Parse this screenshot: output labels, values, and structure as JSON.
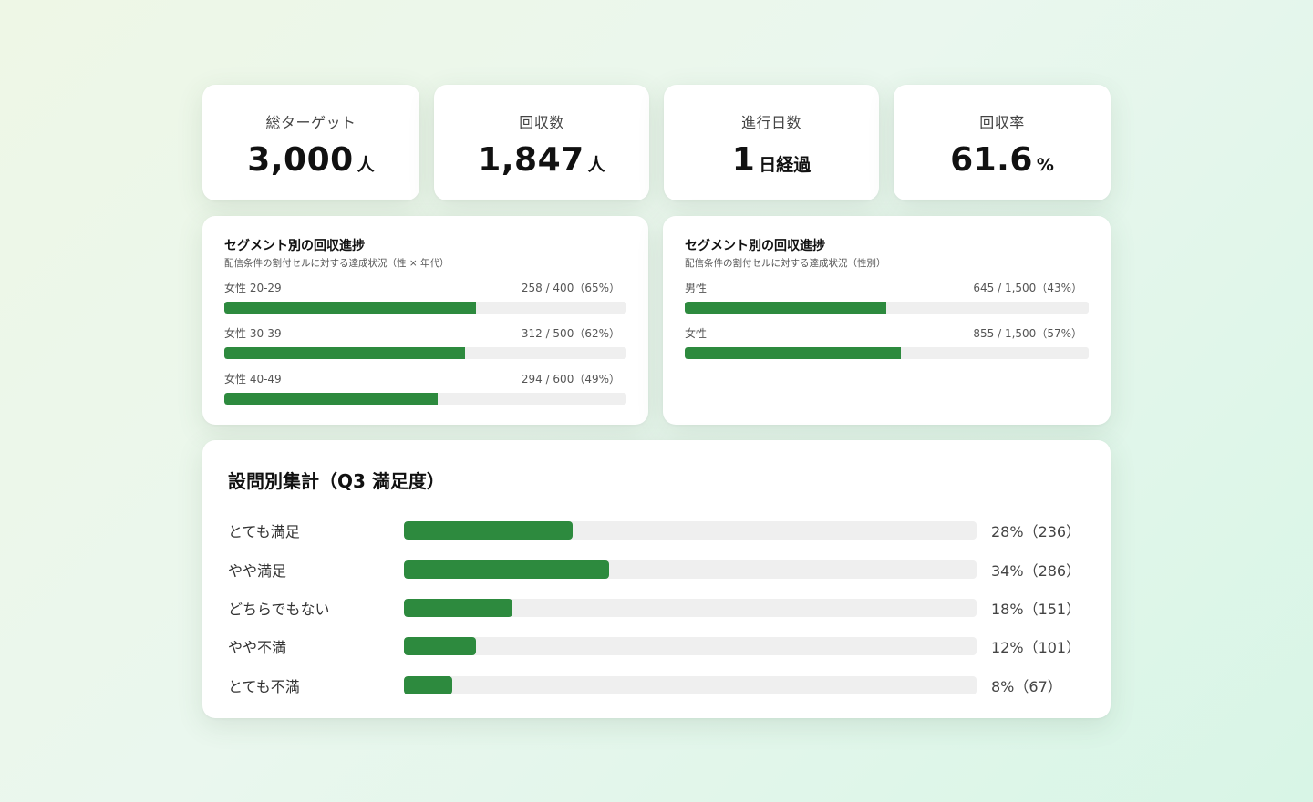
{
  "kpis": [
    {
      "label": "総ターゲット",
      "value": "3,000",
      "unit": "人"
    },
    {
      "label": "回収数",
      "value": "1,847",
      "unit": "人"
    },
    {
      "label": "進行日数",
      "value": "1",
      "unit": "日経過"
    },
    {
      "label": "回収率",
      "value": "61.6",
      "unit": "%"
    }
  ],
  "segment_cards": [
    {
      "title": "セグメント別の回収進捗",
      "subtitle": "配信条件の割付セルに対する達成状況（性 × 年代）",
      "rows": [
        {
          "label": "女性 20-29",
          "value_text": "258 / 400（65%）",
          "progress": 0.625
        },
        {
          "label": "女性 30-39",
          "value_text": "312 / 500（62%）",
          "progress": 0.598
        },
        {
          "label": "女性 40-49",
          "value_text": "294 / 600（49%）",
          "progress": 0.531
        }
      ]
    },
    {
      "title": "セグメント別の回収進捗",
      "subtitle": "配信条件の割付セルに対する達成状況（性別）",
      "rows": [
        {
          "label": "男性",
          "value_text": "645 / 1,500（43%）",
          "progress": 0.498
        },
        {
          "label": "女性",
          "value_text": "855 / 1,500（57%）",
          "progress": 0.534
        }
      ]
    }
  ],
  "question": {
    "title": "設問別集計（Q3 満足度）",
    "rows": [
      {
        "label": "とても満足",
        "value_text": "28%（236）",
        "progress": 0.295
      },
      {
        "label": "やや満足",
        "value_text": "34%（286）",
        "progress": 0.358
      },
      {
        "label": "どちらでもない",
        "value_text": "18%（151）",
        "progress": 0.19
      },
      {
        "label": "やや不満",
        "value_text": "12%（101）",
        "progress": 0.125
      },
      {
        "label": "とても不満",
        "value_text": "8%（67）",
        "progress": 0.085
      }
    ]
  },
  "colors": {
    "accent": "#2d8a3e",
    "track": "#efefef"
  }
}
